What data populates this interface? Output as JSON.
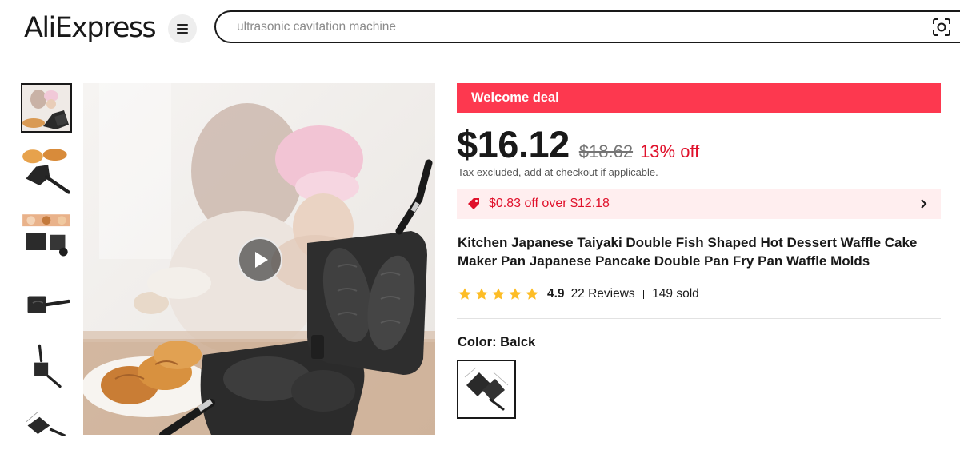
{
  "header": {
    "logo_text": "AliExpress",
    "menu_icon": "hamburger-menu-icon",
    "search_placeholder": "ultrasonic cavitation machine",
    "camera_icon": "image-search-icon"
  },
  "gallery": {
    "thumbnail_count": 6,
    "active_index": 0,
    "play_icon": "play-icon"
  },
  "deal": {
    "banner_label": "Welcome deal",
    "banner_color": "#fd384f"
  },
  "price": {
    "current": "$16.12",
    "original": "$18.62",
    "discount": "13% off",
    "tax_note": "Tax excluded, add at checkout if applicable."
  },
  "coupon": {
    "icon": "coupon-tag-icon",
    "text": "$0.83 off over $12.18",
    "chevron": "chevron-right-icon"
  },
  "product": {
    "title": "Kitchen Japanese Taiyaki Double Fish Shaped Hot Dessert Waffle Cake Maker Pan Japanese Pancake Double Pan Fry Pan Waffle Molds"
  },
  "rating": {
    "stars": 5,
    "value": "4.9",
    "reviews": "22 Reviews",
    "sold": "149 sold",
    "star_color": "#fdbd26"
  },
  "variants": {
    "color_label": "Color: Balck",
    "selected_index": 0
  },
  "colors": {
    "accent_red": "#e0112b",
    "coupon_bg": "#ffeeef"
  }
}
